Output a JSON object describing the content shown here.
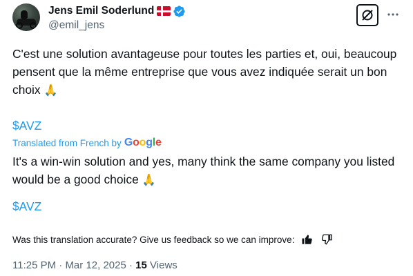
{
  "author": {
    "display_name": "Jens Emil Soderlund",
    "handle": "@emil_jens",
    "flag": "Denmark flag",
    "verified": true
  },
  "post": {
    "original_text": "C'est une solution avantageuse pour toutes les parties et, oui, beaucoup pensent que la même entreprise que vous avez indiquée serait un bon choix",
    "original_emoji": "🙏",
    "original_cashtag": "$AVZ",
    "translated_label": "Translated from French by",
    "translator_brand": "Google",
    "translated_text": "It's a win-win solution and yes, many think the same company you listed would be a good choice",
    "translated_emoji": "🙏",
    "translated_cashtag": "$AVZ"
  },
  "feedback": {
    "prompt": "Was this translation accurate? Give us feedback so we can improve:",
    "thumbs_up_icon": "thumbs-up-icon",
    "thumbs_down_icon": "thumbs-down-icon"
  },
  "meta": {
    "time": "11:25 PM",
    "separator": " · ",
    "date": "Mar 12, 2025",
    "views_count": "15",
    "views_label": "Views"
  },
  "icons": {
    "grok": "grok-icon",
    "more": "more-icon",
    "verified": "verified-badge-icon"
  },
  "colors": {
    "text": "#0f1419",
    "secondary": "#536471",
    "link": "#1d9bf0",
    "verified": "#1d9bf0"
  }
}
